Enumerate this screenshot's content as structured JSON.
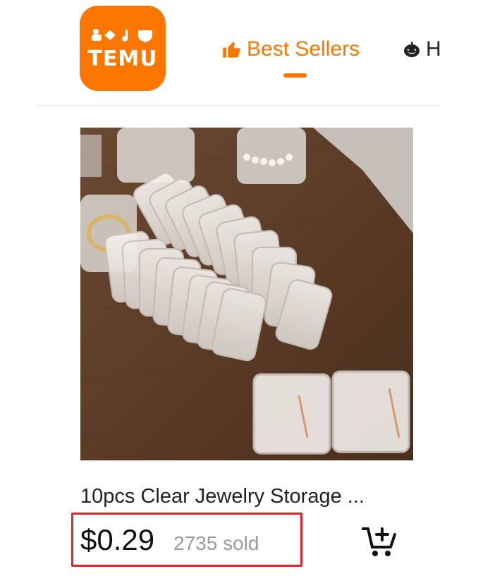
{
  "logo": {
    "glyphs": "⛄◇♪♔",
    "text": "TEMU",
    "brand_color": "#fb7701"
  },
  "nav": {
    "active_tab": {
      "label": "Best Sellers",
      "icon": "thumbs-up-icon",
      "color": "#fb7701"
    },
    "next_tab": {
      "label": "H",
      "icon": "pumpkin-icon"
    }
  },
  "product": {
    "title": "10pcs Clear Jewelry Storage ...",
    "price": "$0.29",
    "sold": "2735 sold",
    "cart_icon": "add-to-cart-icon"
  },
  "highlight_color": "#e8202a"
}
